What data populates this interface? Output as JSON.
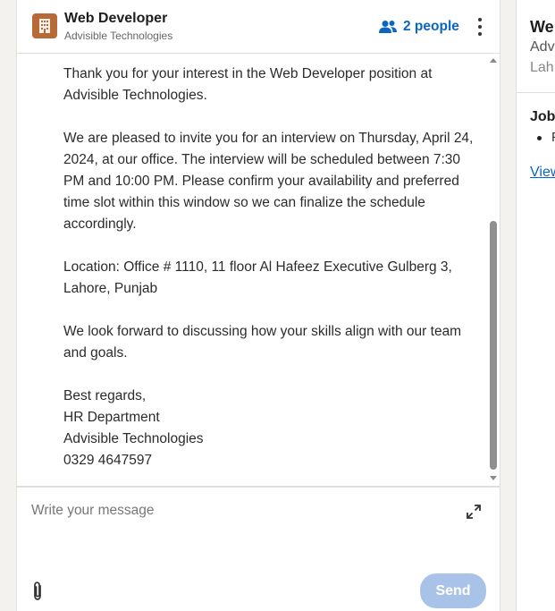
{
  "conversation": {
    "title": "Web Developer",
    "subtitle": "Advisible Technologies",
    "participants_label": "2 people"
  },
  "message": {
    "paragraphs": [
      "Thank you for your interest in the Web Developer position at Advisible Technologies.",
      "We are pleased to invite you for an interview on Thursday, April 24, 2024, at our office. The interview will be scheduled between 7:30 PM and 10:00 PM. Please confirm your availability and preferred time slot within this window so we can finalize the schedule accordingly.",
      "Location: Office # 1110, 11 floor Al Hafeez Executive Gulberg 3, Lahore, Punjab",
      "We look forward to discussing how your skills align with our team and goals."
    ],
    "signature": [
      "Best regards,",
      "HR Department",
      "Advisible Technologies",
      "0329 4647597"
    ]
  },
  "composer": {
    "placeholder": "Write your message",
    "send_label": "Send"
  },
  "side_panel": {
    "title": "We",
    "company": "Adv",
    "location": "Lah",
    "section_title": "Job",
    "bullet_text": "F",
    "link_text": "View"
  },
  "colors": {
    "accent": "#0a66c2",
    "send_disabled": "#a9c3e8",
    "logo": "#b86a36"
  },
  "icons": [
    "building-icon",
    "people-icon",
    "more-vertical-icon",
    "expand-icon",
    "paperclip-icon"
  ]
}
